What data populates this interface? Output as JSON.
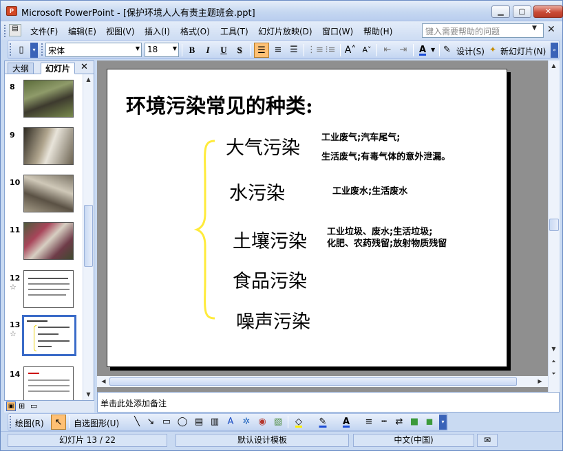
{
  "window": {
    "title": "Microsoft PowerPoint - [保护环境人人有责主题班会.ppt]",
    "app_icon": "powerpoint-icon",
    "controls": {
      "minimize": "▁",
      "maximize": "▢",
      "close": "✕"
    }
  },
  "menubar": {
    "items": [
      "文件(F)",
      "编辑(E)",
      "视图(V)",
      "插入(I)",
      "格式(O)",
      "工具(T)",
      "幻灯片放映(D)",
      "窗口(W)",
      "帮助(H)"
    ],
    "help_placeholder": "键入需要帮助的问题",
    "close": "✕"
  },
  "toolbar": {
    "font_name": "宋体",
    "font_size": "18",
    "bold": "B",
    "italic": "I",
    "underline": "U",
    "shadow": "S",
    "design_label": "设计(S)",
    "new_slide_label": "新幻灯片(N)"
  },
  "left_pane": {
    "tab_outline": "大纲",
    "tab_slides": "幻灯片",
    "close": "✕",
    "thumbnails": [
      {
        "number": "8",
        "star": ""
      },
      {
        "number": "9",
        "star": ""
      },
      {
        "number": "10",
        "star": ""
      },
      {
        "number": "11",
        "star": ""
      },
      {
        "number": "12",
        "star": "☆"
      },
      {
        "number": "13",
        "star": "☆"
      },
      {
        "number": "14",
        "star": ""
      }
    ],
    "selected_slide": "13"
  },
  "slide": {
    "title": "环境污染常见的种类:",
    "categories": [
      {
        "name": "大气污染",
        "lines": [
          "工业废气;汽车尾气;",
          "生活废气;有毒气体的意外泄漏。"
        ]
      },
      {
        "name": "水污染",
        "lines": [
          "工业废水;生活废水"
        ]
      },
      {
        "name": "土壤污染",
        "lines": [
          "工业垃圾、废水;生活垃圾;",
          "化肥、农药残留;放射物质残留"
        ]
      },
      {
        "name": "食品污染",
        "lines": []
      },
      {
        "name": "噪声污染",
        "lines": []
      }
    ],
    "brace_color": "#ffeb3b"
  },
  "notes": {
    "placeholder": "单击此处添加备注"
  },
  "drawbar": {
    "draw_label": "绘图(R)",
    "autoshapes_label": "自选图形(U)"
  },
  "status": {
    "slide_info": "幻灯片 13 / 22",
    "template": "默认设计模板",
    "language": "中文(中国)"
  },
  "colors": {
    "accent": "#3a6bc8",
    "toolbar": "#c3d5f1",
    "highlight": "#ffc074"
  }
}
